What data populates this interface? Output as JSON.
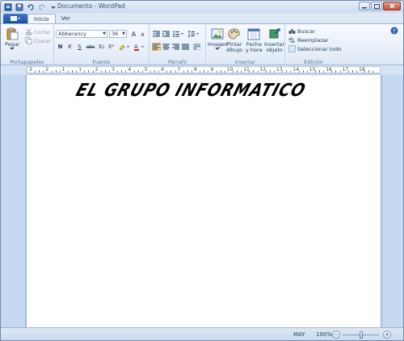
{
  "window": {
    "title": "Documento - WordPad"
  },
  "colors": {
    "accent": "#1d4f9b",
    "ribbon_bg": "#dfe9f6",
    "selected": "#fbe3a4"
  },
  "tabs": [
    {
      "label": "Inicio",
      "active": true
    },
    {
      "label": "Ver",
      "active": false
    }
  ],
  "ribbon": {
    "portapapeles": {
      "label": "Portapapeles",
      "paste": "Pegar",
      "cut": "Cortar",
      "copy": "Copiar"
    },
    "fuente": {
      "label": "Fuente",
      "font_name": "Abberancy",
      "font_size": "36",
      "bold": "N",
      "italic": "K",
      "underline": "S",
      "strike": "abc",
      "subscript": "X₂",
      "superscript": "X²",
      "grow": "A",
      "shrink": "A"
    },
    "parrafo": {
      "label": "Párrafo"
    },
    "insertar": {
      "label": "Insertar",
      "image": "Imagen",
      "paint_1": "Pintar",
      "paint_2": "dibujo",
      "datetime_1": "Fecha",
      "datetime_2": "y hora",
      "object_1": "Insertar",
      "object_2": "objeto"
    },
    "edicion": {
      "label": "Edición",
      "find": "Buscar",
      "replace": "Reemplazar",
      "select_all": "Seleccionar todo"
    }
  },
  "ruler": {
    "numbers": [
      "3",
      "2",
      "1",
      "1",
      "2",
      "3",
      "4",
      "5",
      "6",
      "7",
      "8",
      "9",
      "10",
      "11",
      "12",
      "13",
      "14",
      "15",
      "16",
      "17",
      "18"
    ]
  },
  "document": {
    "text": "EL GRUPO INFORMATICO"
  },
  "status": {
    "caps": "MAY",
    "zoom": "100%",
    "zoom_out": "−",
    "zoom_in": "+",
    "zoom_level": 0.5
  }
}
